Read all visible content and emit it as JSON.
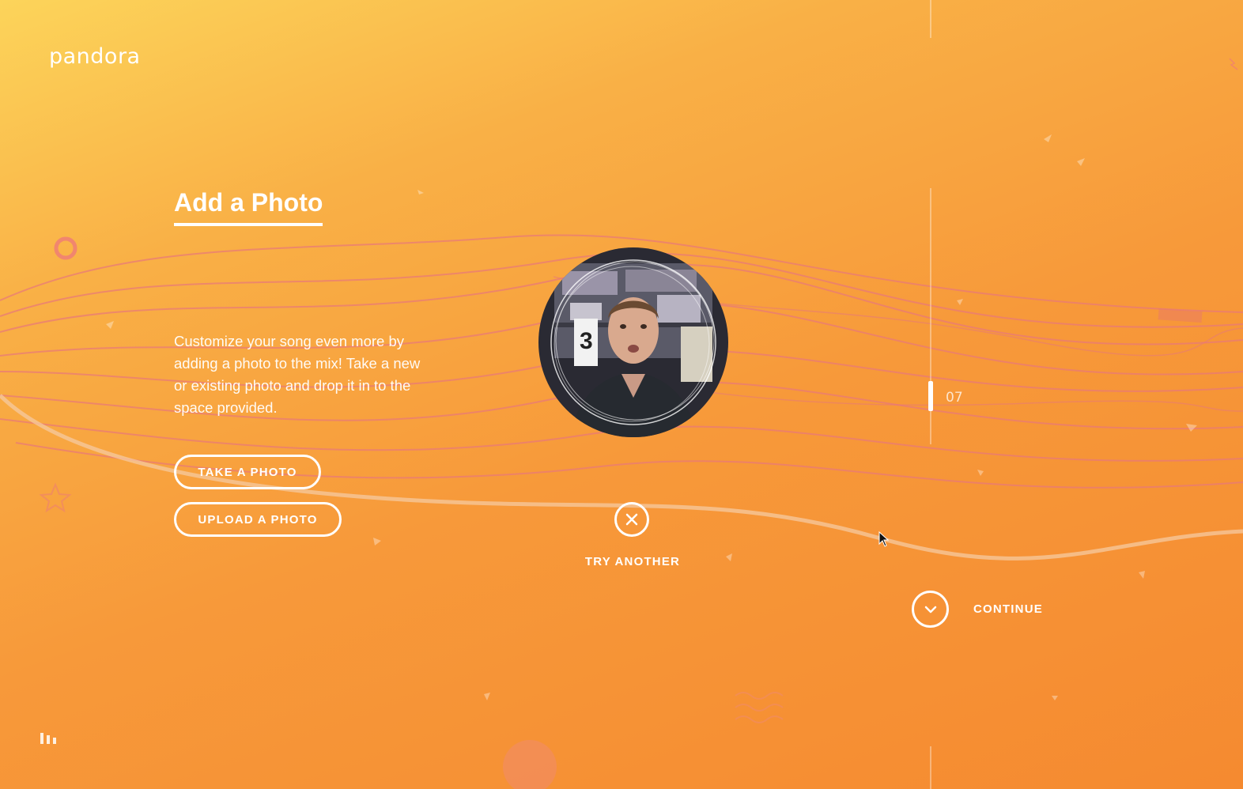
{
  "brand": {
    "logo_text": "pandora"
  },
  "main": {
    "title": "Add a Photo",
    "description": "Customize your song even more by adding a photo to the mix! Take a new or existing photo and drop it in to the space provided.",
    "take_photo_label": "TAKE A PHOTO",
    "upload_photo_label": "UPLOAD A PHOTO",
    "try_another_label": "TRY ANOTHER",
    "continue_label": "CONTINUE"
  },
  "progress": {
    "step_number": "07"
  },
  "colors": {
    "background_start": "#fcd45a",
    "background_end": "#f58a30",
    "accent": "#ffffff",
    "wave": "#e8787a"
  },
  "icons": {
    "try_another": "close-icon",
    "continue": "chevron-down-icon",
    "audio": "equalizer-icon"
  }
}
